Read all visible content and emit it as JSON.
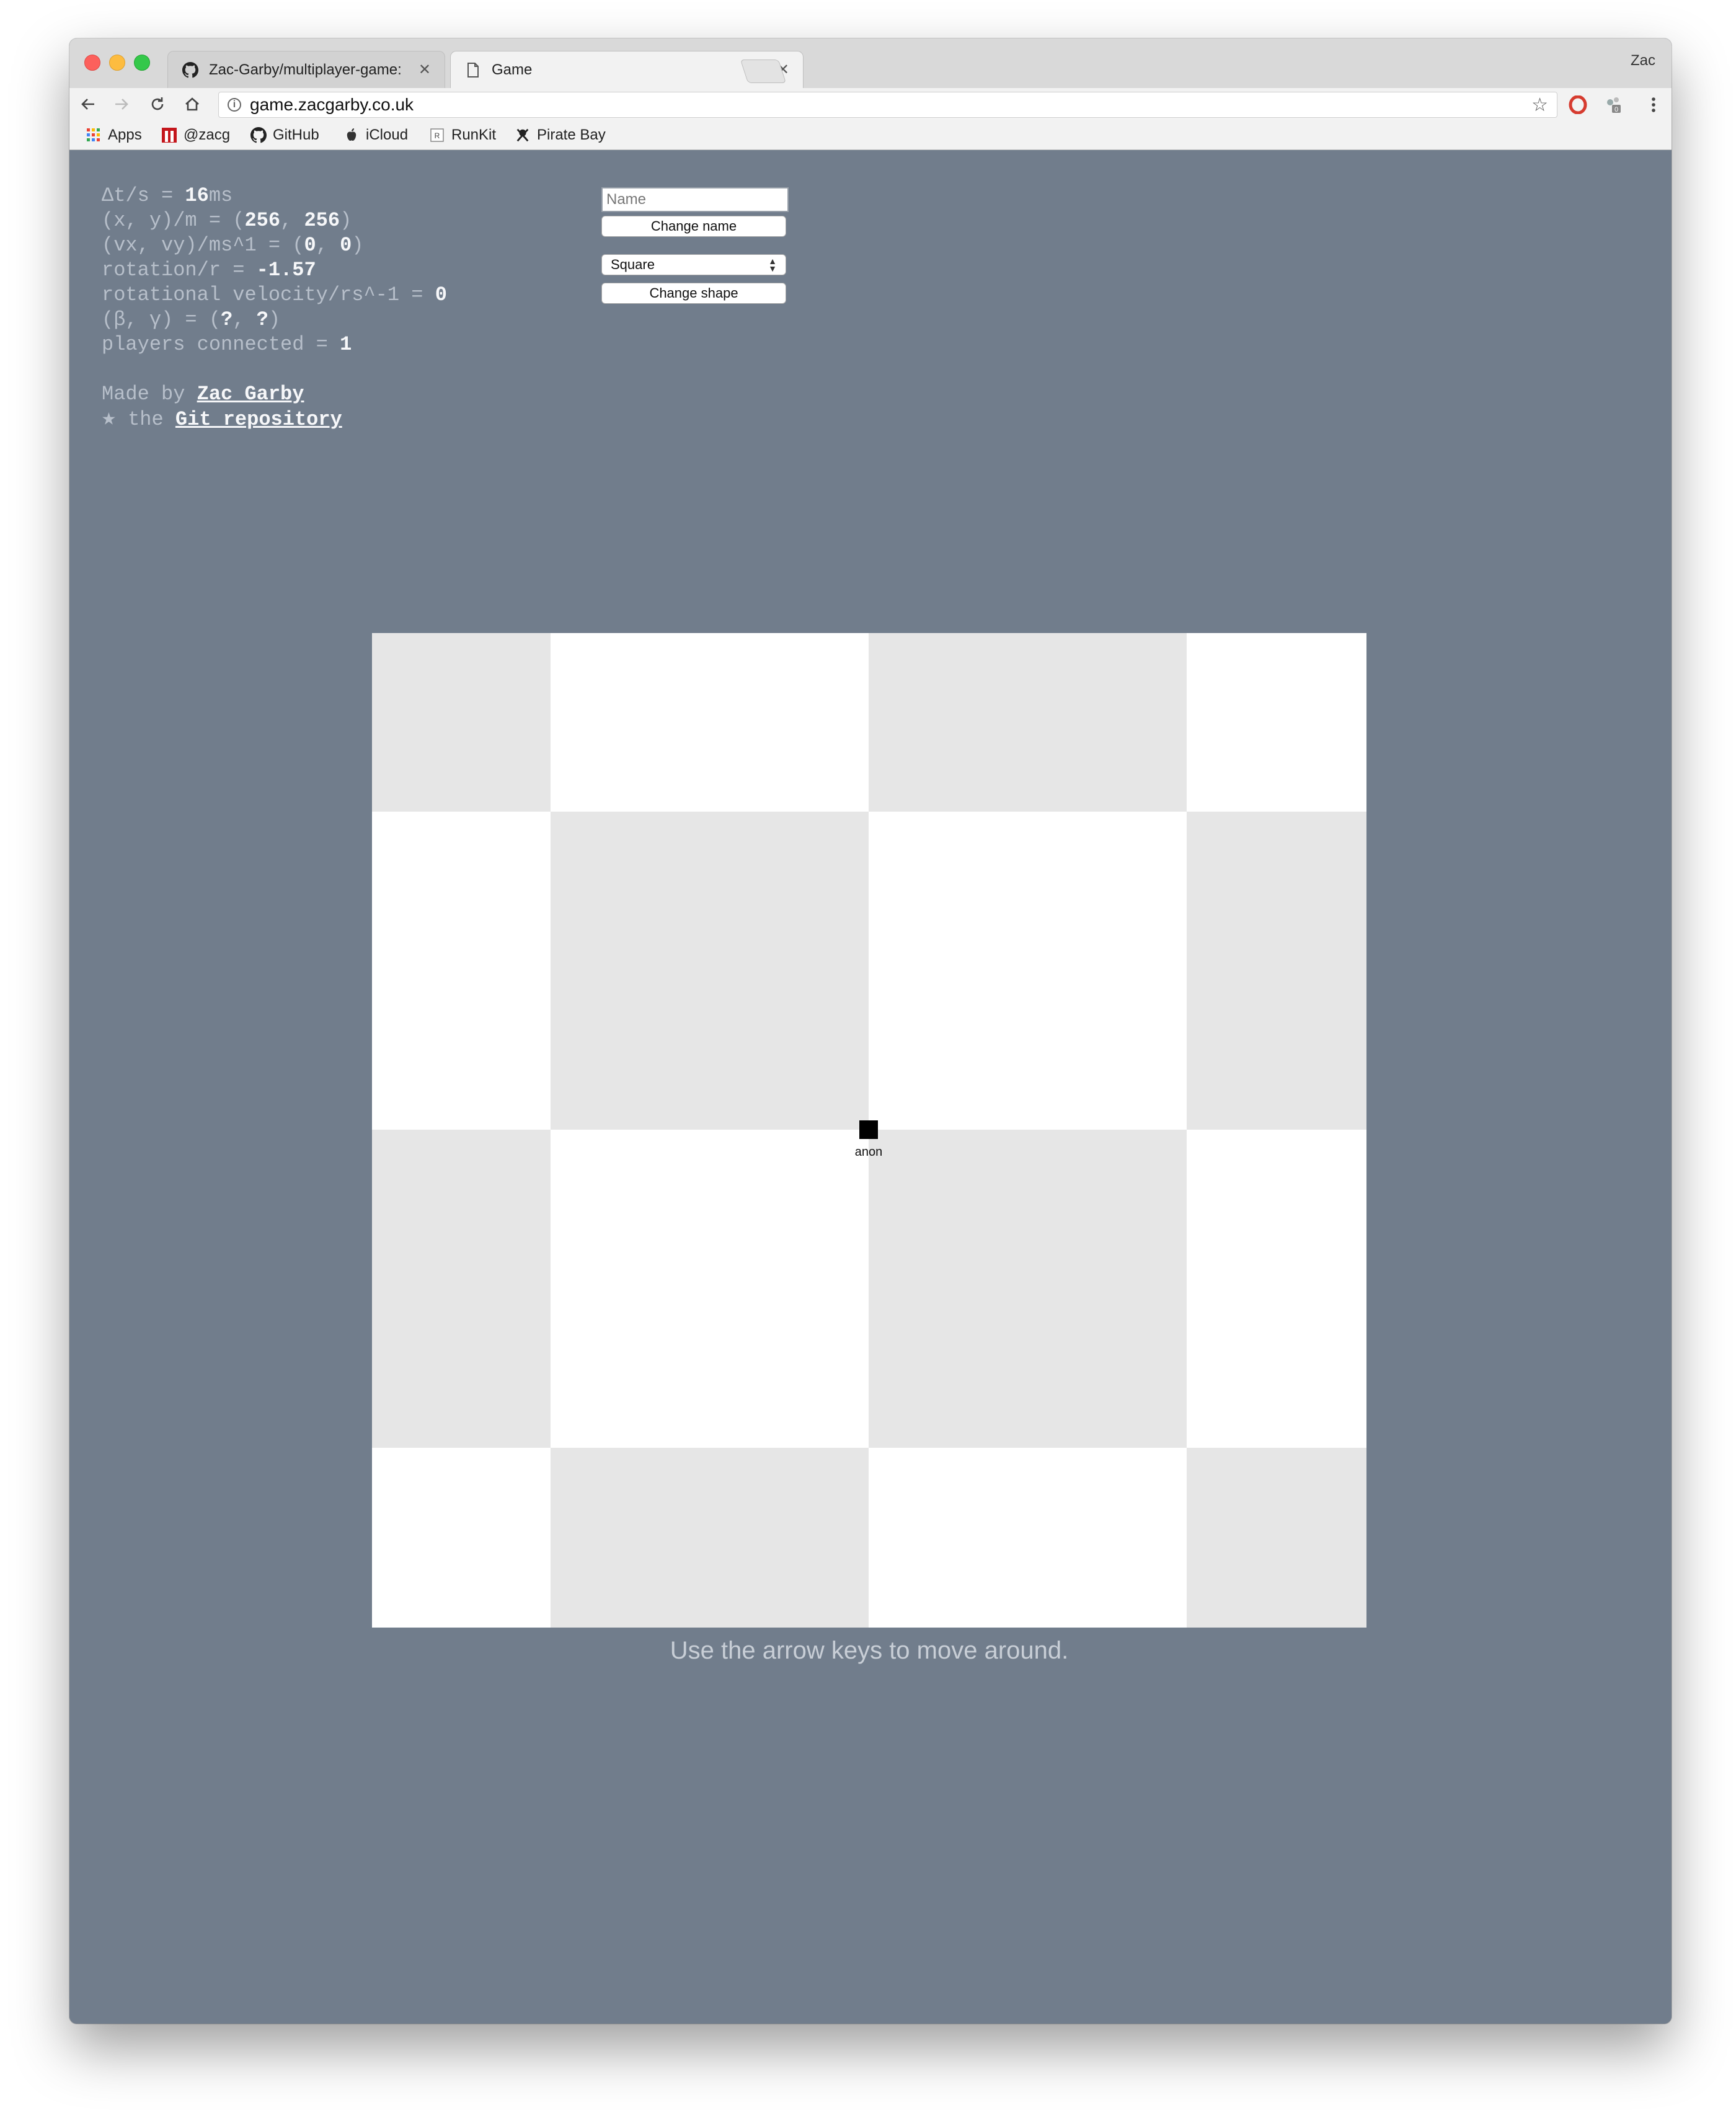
{
  "browser": {
    "tabs": [
      {
        "title": "Zac-Garby/multiplayer-game: ",
        "icon": "github-icon",
        "active": false
      },
      {
        "title": "Game",
        "icon": "document-icon",
        "active": true
      }
    ],
    "profile_name": "Zac",
    "url": "game.zacgarby.co.uk",
    "bookmarks": [
      {
        "label": "Apps",
        "icon": "apps-grid-icon"
      },
      {
        "label": "@zacg",
        "icon": "zacg-icon"
      },
      {
        "label": "GitHub",
        "icon": "github-icon"
      },
      {
        "label": "iCloud",
        "icon": "apple-icon"
      },
      {
        "label": "RunKit",
        "icon": "runkit-icon"
      },
      {
        "label": "Pirate Bay",
        "icon": "pirate-bay-icon"
      }
    ]
  },
  "stats": {
    "dt_label": "Δt/s = ",
    "dt_value": "16",
    "dt_unit": "ms",
    "pos_label": "(x, y)/m = (",
    "pos_x": "256",
    "pos_sep": ", ",
    "pos_y": "256",
    "pos_close": ")",
    "vel_label": "(vx, vy)/ms^1 = (",
    "vel_x": "0",
    "vel_sep": ", ",
    "vel_y": "0",
    "vel_close": ")",
    "rot_label": "rotation/r = ",
    "rot_value": "-1.57",
    "rotvel_label": "rotational velocity/rs^-1 = ",
    "rotvel_value": "0",
    "orient_label": "(β, γ) = (",
    "beta": "?",
    "orient_sep": ", ",
    "gamma": "?",
    "orient_close": ")",
    "players_label": "players connected = ",
    "players_value": "1"
  },
  "credits": {
    "made_by_label": "Made by ",
    "author": "Zac Garby",
    "star_symbol": "★",
    "star_text": " the ",
    "repo_link": "Git repository"
  },
  "controls": {
    "name_placeholder": "Name",
    "change_name_label": "Change name",
    "shape_selected": "Square",
    "change_shape_label": "Change shape"
  },
  "board": {
    "colors": {
      "light": "#ffffff",
      "dark": "#e6e6e6",
      "background": "#717d8c"
    },
    "player_name": "anon",
    "player_shape": "square"
  },
  "hint": "Use the arrow keys to move around."
}
